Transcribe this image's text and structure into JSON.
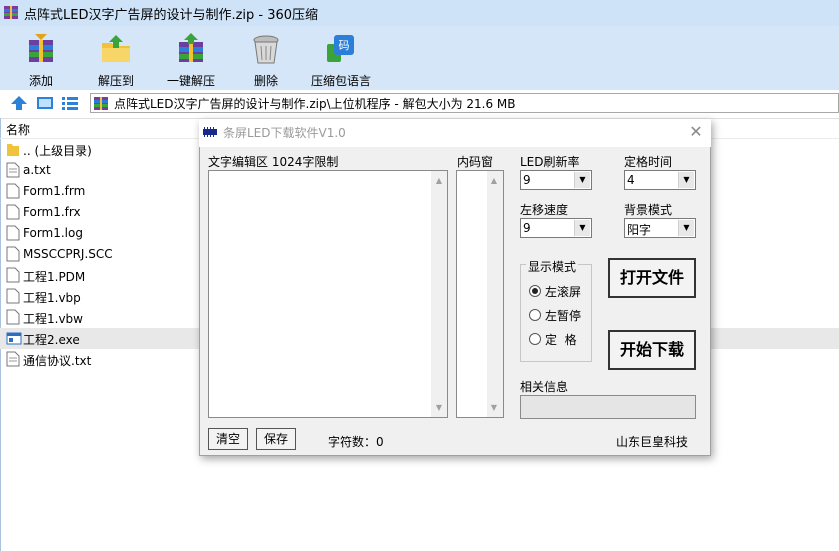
{
  "window": {
    "title": "点阵式LED汉字广告屏的设计与制作.zip - 360压缩"
  },
  "toolbar": {
    "buttons": [
      {
        "label": "添加",
        "icon": "add-archive-icon"
      },
      {
        "label": "解压到",
        "icon": "extract-to-icon"
      },
      {
        "label": "一键解压",
        "icon": "one-click-extract-icon"
      },
      {
        "label": "删除",
        "icon": "delete-icon"
      },
      {
        "label": "压缩包语言",
        "icon": "archive-language-icon"
      }
    ]
  },
  "address": {
    "path": "点阵式LED汉字广告屏的设计与制作.zip\\上位机程序 - 解包大小为 21.6 MB"
  },
  "filelist": {
    "header": "名称",
    "files": [
      {
        "name": ".. (上级目录)",
        "icon": "folder-icon"
      },
      {
        "name": "a.txt",
        "icon": "file-icon"
      },
      {
        "name": "Form1.frm",
        "icon": "file-icon"
      },
      {
        "name": "Form1.frx",
        "icon": "file-icon"
      },
      {
        "name": "Form1.log",
        "icon": "file-icon"
      },
      {
        "name": "MSSCCPRJ.SCC",
        "icon": "file-icon"
      },
      {
        "name": "工程1.PDM",
        "icon": "file-icon"
      },
      {
        "name": "工程1.vbp",
        "icon": "file-icon"
      },
      {
        "name": "工程1.vbw",
        "icon": "file-icon"
      },
      {
        "name": "工程2.exe",
        "icon": "exe-icon",
        "selected": true
      },
      {
        "name": "通信协议.txt",
        "icon": "file-icon"
      }
    ]
  },
  "dialog": {
    "title": "条屏LED下载软件V1.0",
    "close": "✕",
    "text_edit_label": "文字编辑区 1024字限制",
    "code_window_label": "内码窗",
    "led_refresh": {
      "label": "LED刷新率",
      "value": "9"
    },
    "hold_time": {
      "label": "定格时间",
      "value": "4"
    },
    "scroll_speed": {
      "label": "左移速度",
      "value": "9"
    },
    "bg_mode": {
      "label": "背景模式",
      "value": "阳字"
    },
    "display_mode": {
      "title": "显示模式",
      "options": [
        {
          "label": "左滚屏",
          "checked": true
        },
        {
          "label": "左暂停",
          "checked": false
        },
        {
          "label": "定  格",
          "checked": false
        }
      ]
    },
    "open_file": "打开文件",
    "start_download": "开始下载",
    "info_label": "相关信息",
    "info_value": "",
    "clear": "清空",
    "save": "保存",
    "char_count": "字符数：0",
    "company": "山东巨皇科技"
  }
}
